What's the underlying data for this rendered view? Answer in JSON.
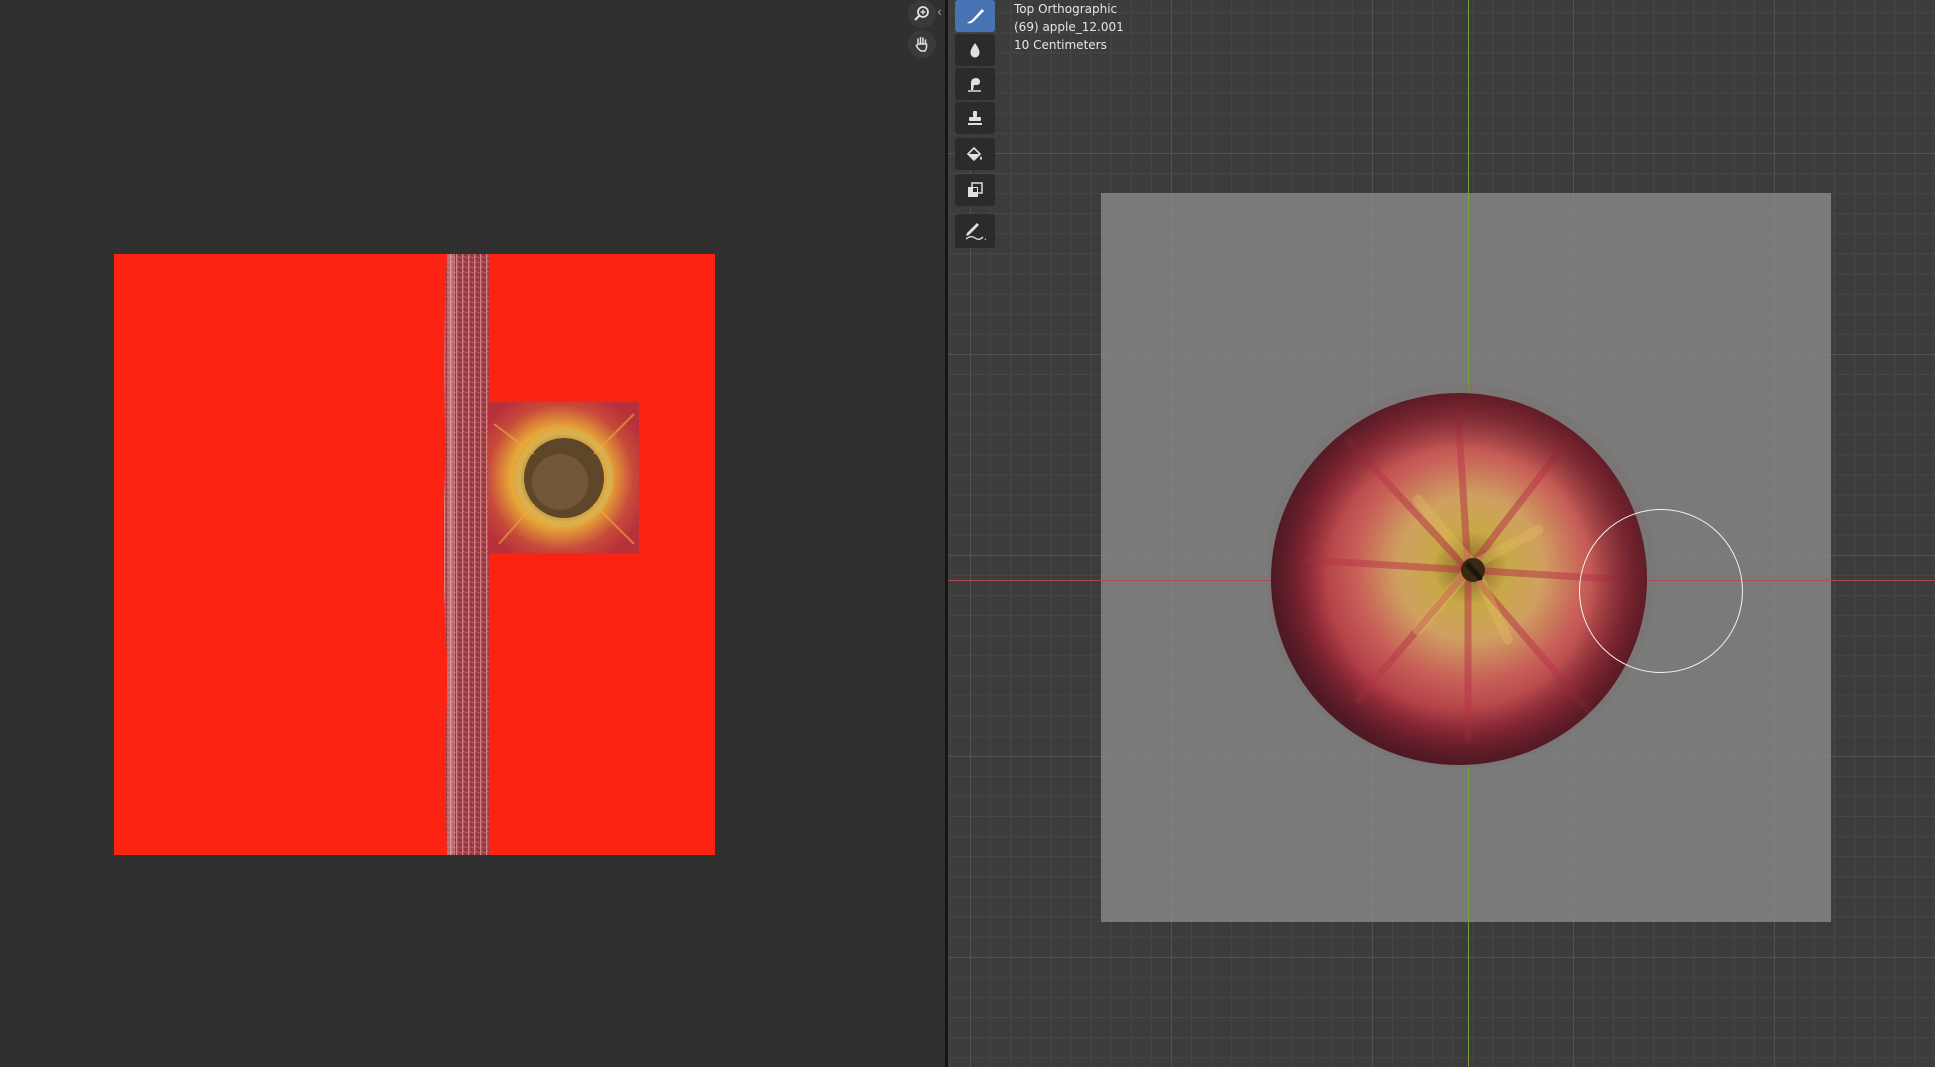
{
  "viewport": {
    "view_name": "Top Orthographic",
    "object_info": "(69) apple_12.001",
    "scale_info": "10 Centimeters"
  },
  "image_editor": {
    "nav_icons": [
      "zoom-icon",
      "pan-hand-icon"
    ],
    "collapse_icon": "chevron-left-icon"
  },
  "toolbar": {
    "tools": [
      {
        "icon": "draw-brush-icon",
        "active": true
      },
      {
        "icon": "soften-icon",
        "active": false
      },
      {
        "icon": "smear-icon",
        "active": false
      },
      {
        "icon": "clone-stamp-icon",
        "active": false
      },
      {
        "icon": "fill-icon",
        "active": false
      },
      {
        "icon": "mask-icon",
        "active": false
      },
      {
        "icon": "annotate-icon",
        "active": false
      }
    ]
  },
  "colors": {
    "background": "#303030",
    "uv_fill": "#fc2312",
    "active_tool": "#4772b3",
    "x_axis": "#b34a52",
    "y_axis": "#7aa12e"
  }
}
